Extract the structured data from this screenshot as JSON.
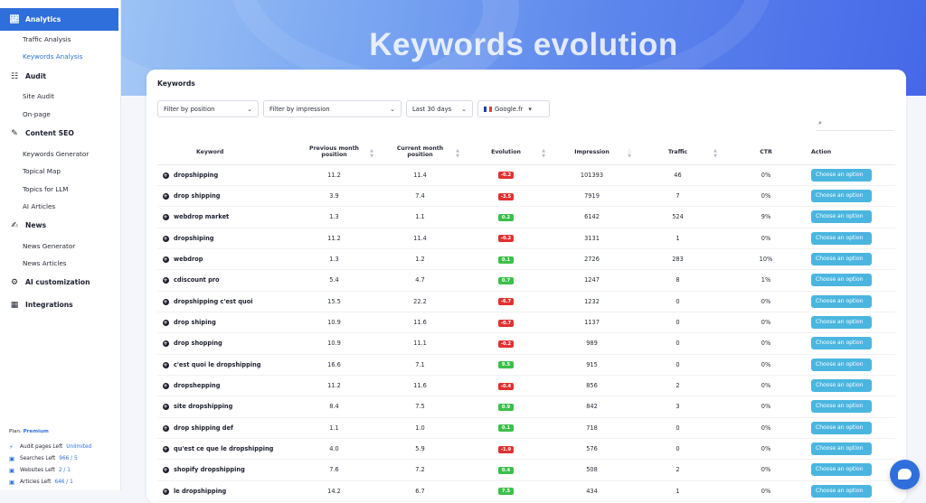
{
  "sidebar": {
    "sections": {
      "analytics": "Analytics",
      "audit": "Audit",
      "content_seo": "Content SEO",
      "news": "News",
      "ai_customization": "AI customization",
      "integrations": "Integrations"
    },
    "items": {
      "traffic_analysis": "Traffic Analysis",
      "keywords_analysis": "Keywords Analysis",
      "site_audit": "Site Audit",
      "on_page": "On-page",
      "keywords_generator": "Keywords Generator",
      "topical_map": "Topical Map",
      "topics_for_llm": "Topics for LLM",
      "ai_articles": "AI Articles",
      "news_generator": "News Generator",
      "news_articles": "News Articles"
    },
    "plan_label": "Plan:",
    "plan_value": "Premium",
    "quotas": [
      {
        "label": "Audit pages Left",
        "value": "Unlimited"
      },
      {
        "label": "Searches Left",
        "value": "966 / 5"
      },
      {
        "label": "Websites Left",
        "value": "2 / 1"
      },
      {
        "label": "Articles Left",
        "value": "646 / 1"
      }
    ]
  },
  "hero": {
    "title": "Keywords evolution"
  },
  "card": {
    "title": "Keywords",
    "filters": {
      "position": "Filter by position",
      "impression": "Filter by impression",
      "period": "Last 30 days",
      "engine": "Google.fr"
    }
  },
  "table": {
    "headers": {
      "keyword": "Keyword",
      "prev_line1": "Previous month",
      "prev_line2": "position",
      "curr_line1": "Current month",
      "curr_line2": "position",
      "evolution": "Evolution",
      "impression": "Impression",
      "traffic": "Traffic",
      "ctr": "CTR",
      "action": "Action"
    },
    "action_label": "Choose an option",
    "rows": [
      {
        "keyword": "dropshipping",
        "prev": "11.2",
        "curr": "11.4",
        "evo": "-0.2",
        "trend": "neg",
        "impression": "101393",
        "traffic": "46",
        "ctr": "0%"
      },
      {
        "keyword": "drop shipping",
        "prev": "3.9",
        "curr": "7.4",
        "evo": "-3.5",
        "trend": "neg",
        "impression": "7919",
        "traffic": "7",
        "ctr": "0%"
      },
      {
        "keyword": "webdrop market",
        "prev": "1.3",
        "curr": "1.1",
        "evo": "0.2",
        "trend": "pos",
        "impression": "6142",
        "traffic": "524",
        "ctr": "9%"
      },
      {
        "keyword": "dropshiping",
        "prev": "11.2",
        "curr": "11.4",
        "evo": "-0.2",
        "trend": "neg",
        "impression": "3131",
        "traffic": "1",
        "ctr": "0%"
      },
      {
        "keyword": "webdrop",
        "prev": "1.3",
        "curr": "1.2",
        "evo": "0.1",
        "trend": "pos",
        "impression": "2726",
        "traffic": "283",
        "ctr": "10%"
      },
      {
        "keyword": "cdiscount pro",
        "prev": "5.4",
        "curr": "4.7",
        "evo": "0.7",
        "trend": "pos",
        "impression": "1247",
        "traffic": "8",
        "ctr": "1%"
      },
      {
        "keyword": "dropshipping c'est quoi",
        "prev": "15.5",
        "curr": "22.2",
        "evo": "-6.7",
        "trend": "neg",
        "impression": "1232",
        "traffic": "0",
        "ctr": "0%"
      },
      {
        "keyword": "drop shiping",
        "prev": "10.9",
        "curr": "11.6",
        "evo": "-0.7",
        "trend": "neg",
        "impression": "1137",
        "traffic": "0",
        "ctr": "0%"
      },
      {
        "keyword": "drop shopping",
        "prev": "10.9",
        "curr": "11.1",
        "evo": "-0.2",
        "trend": "neg",
        "impression": "989",
        "traffic": "0",
        "ctr": "0%"
      },
      {
        "keyword": "c'est quoi le dropshipping",
        "prev": "16.6",
        "curr": "7.1",
        "evo": "9.5",
        "trend": "pos",
        "impression": "915",
        "traffic": "0",
        "ctr": "0%"
      },
      {
        "keyword": "dropshepping",
        "prev": "11.2",
        "curr": "11.6",
        "evo": "-0.4",
        "trend": "neg",
        "impression": "856",
        "traffic": "2",
        "ctr": "0%"
      },
      {
        "keyword": "site dropshipping",
        "prev": "8.4",
        "curr": "7.5",
        "evo": "0.9",
        "trend": "pos",
        "impression": "842",
        "traffic": "3",
        "ctr": "0%"
      },
      {
        "keyword": "drop shipping def",
        "prev": "1.1",
        "curr": "1.0",
        "evo": "0.1",
        "trend": "pos",
        "impression": "718",
        "traffic": "0",
        "ctr": "0%"
      },
      {
        "keyword": "qu'est ce que le dropshipping",
        "prev": "4.0",
        "curr": "5.9",
        "evo": "-1.9",
        "trend": "neg",
        "impression": "576",
        "traffic": "0",
        "ctr": "0%"
      },
      {
        "keyword": "shopify dropshipping",
        "prev": "7.6",
        "curr": "7.2",
        "evo": "0.4",
        "trend": "pos",
        "impression": "508",
        "traffic": "2",
        "ctr": "0%"
      },
      {
        "keyword": "le dropshipping",
        "prev": "14.2",
        "curr": "6.7",
        "evo": "7.5",
        "trend": "pos",
        "impression": "434",
        "traffic": "1",
        "ctr": "0%"
      }
    ]
  },
  "colors": {
    "accent": "#2f6fdb",
    "negative": "#e23030",
    "positive": "#3bbf4a",
    "action_button": "#4ab6e0"
  }
}
